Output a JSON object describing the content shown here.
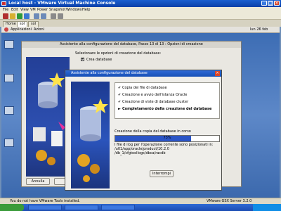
{
  "console": {
    "title": "Local host - VMware Virtual Machine Console",
    "menu": [
      "File",
      "Edit",
      "View",
      "VM",
      "Power",
      "Snapshot",
      "Windows",
      "Help"
    ],
    "tabs": [
      "Home",
      "sol",
      "sol"
    ]
  },
  "guest_panel": {
    "applications": "Applicazioni",
    "actions": "Azioni",
    "clock": "lun 26 feb"
  },
  "back_window": {
    "title": "Assistente alla configurazione del database, Passo 13 di 13 : Opzioni di creazione",
    "heading": "Selezionare le opzioni di creazione del database:",
    "option_create": "Crea database",
    "button_cancel": "Annulla"
  },
  "dialog": {
    "title": "Assistente alla configurazione del database",
    "steps": [
      {
        "label": "Copia dei file di database",
        "mark": "✔",
        "bold": false
      },
      {
        "label": "Creazione e avvio dell'istanza Oracle",
        "mark": "✔",
        "bold": false
      },
      {
        "label": "Creazione di viste di database cluster",
        "mark": "✔",
        "bold": false
      },
      {
        "label": "Completamento della creazione del database",
        "mark": "►",
        "bold": true
      }
    ],
    "progress_label": "Creazione della copia del database in corso",
    "progress_percent": 73,
    "progress_text": "73%",
    "info_lines": [
      "I file di log per l'operazione corrente sono posizionati in:",
      "/u01/app/oracle/product/10.2.0",
      "/db_1/cfgtoollogs/dbca/racdb"
    ],
    "stop_button": "Interrompi"
  },
  "statusbar": {
    "left": "You do not have VMware Tools installed.",
    "right": "VMware GSX Server 3.2.0"
  }
}
